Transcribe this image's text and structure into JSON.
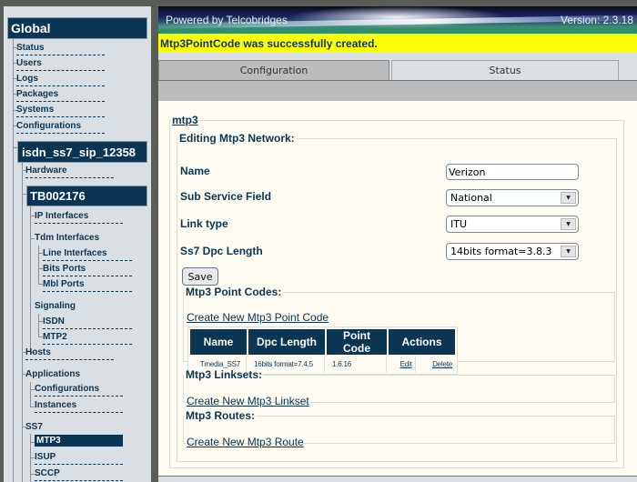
{
  "sidebar": {
    "global_title": "Global",
    "global_items": [
      "Status",
      "Users",
      "Logs",
      "Packages",
      "Systems",
      "Configurations"
    ],
    "host_title": "isdn_ss7_sip_12358",
    "hardware_label": "Hardware",
    "board_title": "TB002176",
    "ip_interfaces": "IP Interfaces",
    "tdm_interfaces": "Tdm Interfaces",
    "tdm_children": [
      "Line Interfaces",
      "Bits Ports",
      "Mbl Ports"
    ],
    "signaling": "Signaling",
    "signaling_children": [
      "ISDN",
      "MTP2"
    ],
    "hosts": "Hosts",
    "applications": "Applications",
    "applications_children": [
      "Configurations",
      "Instances"
    ],
    "ss7": "SS7",
    "ss7_children": [
      "MTP3",
      "ISUP",
      "SCCP"
    ],
    "selected": "MTP3"
  },
  "header": {
    "powered_by": "Powered by Telcobridges",
    "version": "Version: 2.3.18"
  },
  "flash_message": "Mtp3PointCode was successfully created.",
  "tabs": [
    {
      "label": "Configuration",
      "active": true
    },
    {
      "label": "Status",
      "active": false
    }
  ],
  "form": {
    "section_link": "mtp3",
    "legend": "Editing Mtp3 Network:",
    "fields": {
      "name": {
        "label": "Name",
        "value": "Verizon"
      },
      "sub_service_field": {
        "label": "Sub Service Field",
        "value": "National"
      },
      "link_type": {
        "label": "Link type",
        "value": "ITU"
      },
      "dpc_length": {
        "label": "Ss7 Dpc Length",
        "value": "14bits format=3.8.3"
      }
    },
    "save_label": "Save"
  },
  "point_codes": {
    "legend": "Mtp3 Point Codes:",
    "create_link": "Create New Mtp3 Point Code",
    "columns": [
      "Name",
      "Dpc Length",
      "Point Code",
      "Actions"
    ],
    "rows": [
      {
        "name": "Tmedia_SS7",
        "dpc_length": "16bits format=7.4.5",
        "point_code": "1.6.16",
        "edit": "Edit",
        "delete": "Delete"
      }
    ]
  },
  "linksets": {
    "legend": "Mtp3 Linksets:",
    "create_link": "Create New Mtp3 Linkset"
  },
  "routes": {
    "legend": "Mtp3 Routes:",
    "create_link": "Create New Mtp3 Route"
  },
  "colors": {
    "navy": "#0c3553",
    "flash_bg": "#ffff00",
    "content_bg": "#fdfbf2",
    "sidebar_bg": "#d9dfe3"
  }
}
